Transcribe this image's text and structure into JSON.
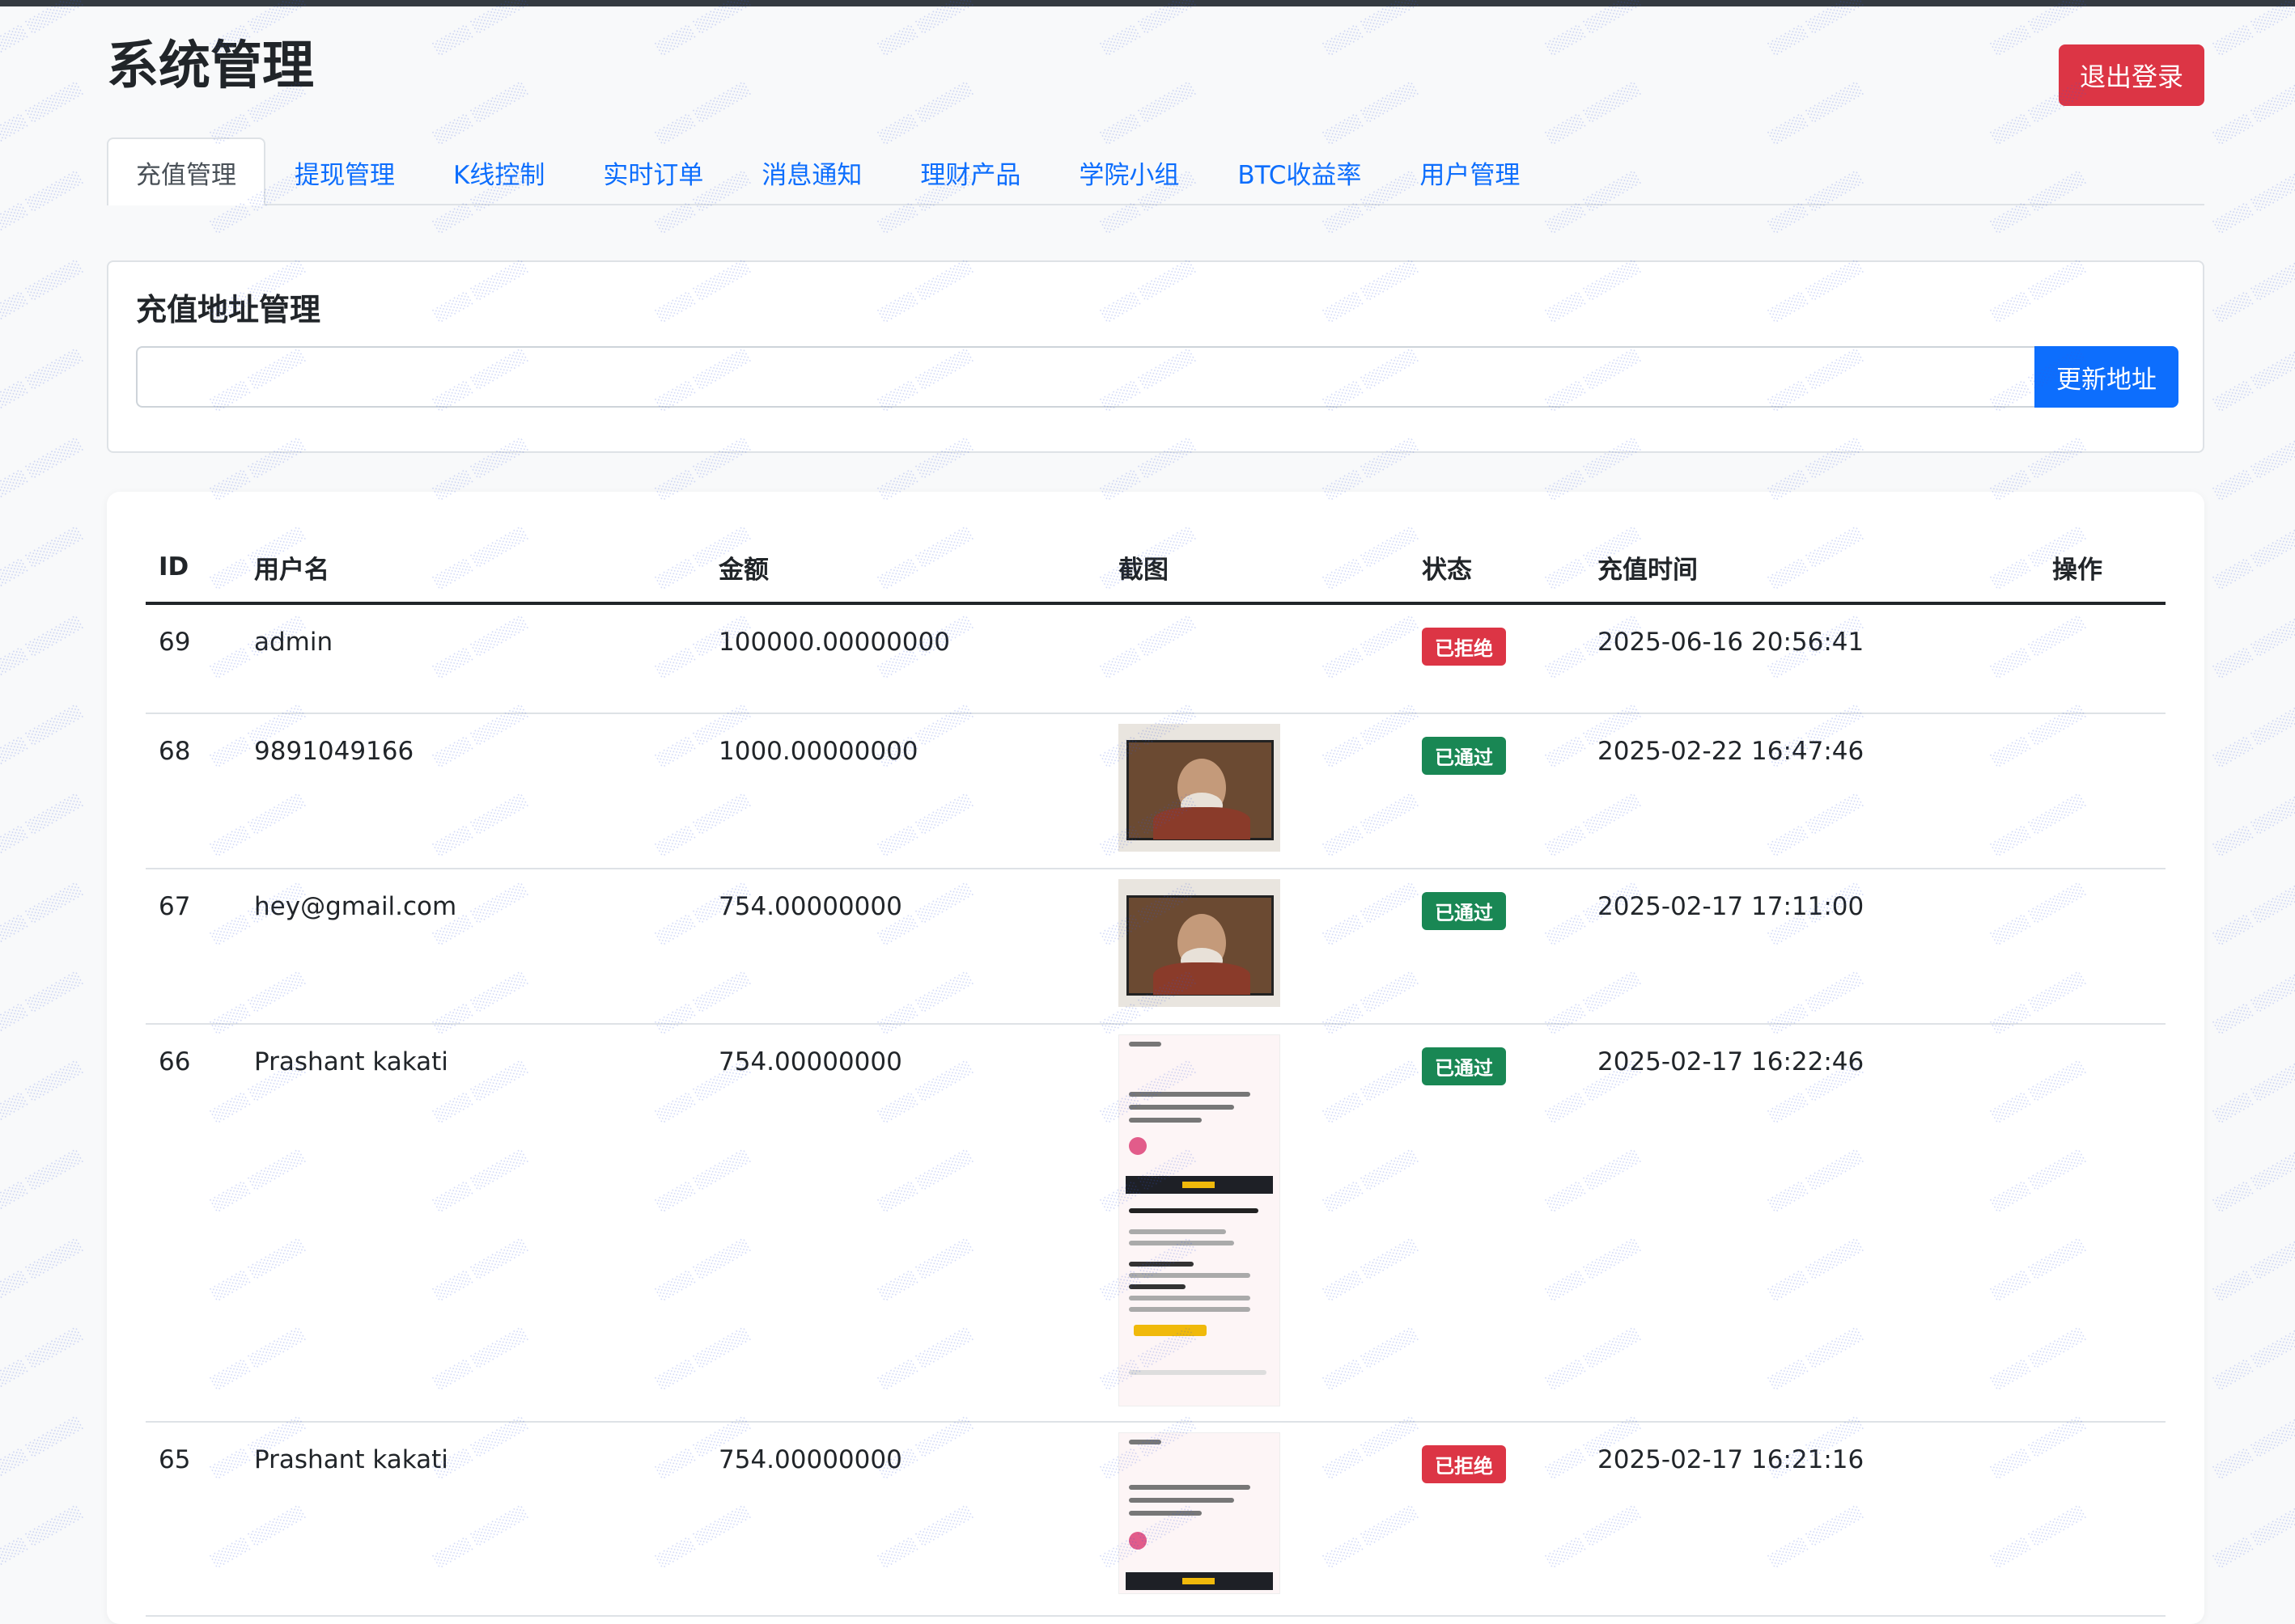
{
  "header": {
    "title": "系统管理",
    "logout_label": "退出登录"
  },
  "tabs": [
    {
      "label": "充值管理",
      "active": true
    },
    {
      "label": "提现管理",
      "active": false
    },
    {
      "label": "K线控制",
      "active": false
    },
    {
      "label": "实时订单",
      "active": false
    },
    {
      "label": "消息通知",
      "active": false
    },
    {
      "label": "理财产品",
      "active": false
    },
    {
      "label": "学院小组",
      "active": false
    },
    {
      "label": "BTC收益率",
      "active": false
    },
    {
      "label": "用户管理",
      "active": false
    }
  ],
  "address_card": {
    "title": "充值地址管理",
    "input_value": "",
    "button_label": "更新地址"
  },
  "table": {
    "headers": [
      "ID",
      "用户名",
      "金额",
      "截图",
      "状态",
      "充值时间",
      "操作"
    ],
    "rows": [
      {
        "id": "69",
        "username": "admin",
        "amount": "100000.00000000",
        "screenshot": "none",
        "status": "已拒绝",
        "time": "2025-06-16 20:56:41"
      },
      {
        "id": "68",
        "username": "9891049166",
        "amount": "1000.00000000",
        "screenshot": "portrait",
        "status": "已通过",
        "time": "2025-02-22 16:47:46"
      },
      {
        "id": "67",
        "username": "hey@gmail.com",
        "amount": "754.00000000",
        "screenshot": "portrait",
        "status": "已通过",
        "time": "2025-02-17 17:11:00"
      },
      {
        "id": "66",
        "username": "Prashant kakati",
        "amount": "754.00000000",
        "screenshot": "phone-tall",
        "status": "已通过",
        "time": "2025-02-17 16:22:46"
      },
      {
        "id": "65",
        "username": "Prashant kakati",
        "amount": "754.00000000",
        "screenshot": "phone-short",
        "status": "已拒绝",
        "time": "2025-02-17 16:21:16"
      }
    ]
  },
  "colors": {
    "primary": "#0d6efd",
    "danger": "#dc3545",
    "success": "#198754",
    "page_bg": "#f8f9fa"
  }
}
